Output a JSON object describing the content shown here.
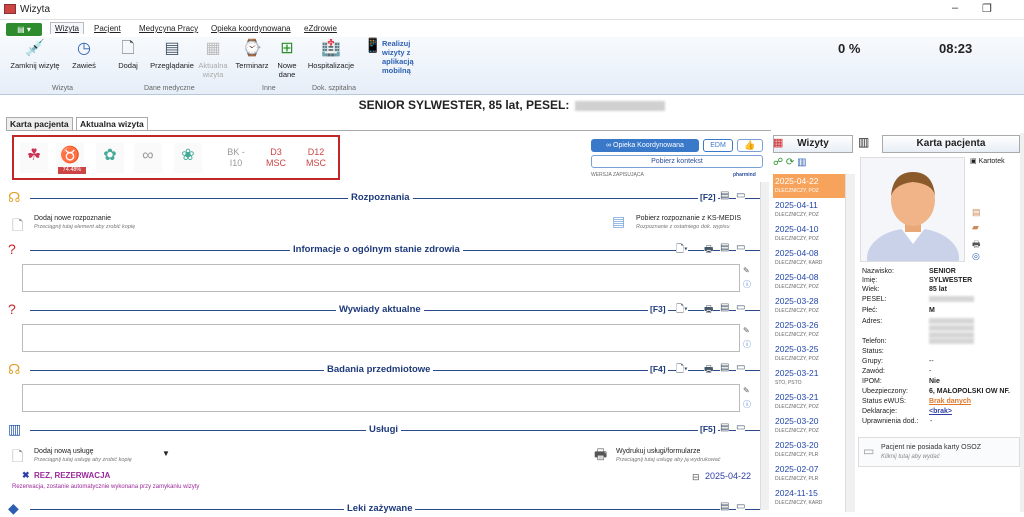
{
  "window": {
    "title": "Wizyta",
    "minimize": "–",
    "restore": "❐"
  },
  "menu": {
    "app_button": "▤ ▾",
    "tabs": [
      "Wizyta",
      "Pacjent",
      "Medycyna Pracy",
      "Opieka koordynowana",
      "eZdrowie"
    ]
  },
  "ribbon": {
    "buttons": [
      {
        "label": "Zamknij wizytę",
        "icon": "syringe-icon"
      },
      {
        "label": "Zawieś",
        "icon": "clock-icon"
      },
      {
        "label": "Dodaj",
        "icon": "document-icon"
      },
      {
        "label": "Przeglądanie",
        "icon": "list-icon"
      },
      {
        "label": "Aktualna wizyta",
        "icon": "calendar-icon"
      },
      {
        "label": "Terminarz",
        "icon": "clock-calendar-icon"
      },
      {
        "label": "Nowe dane",
        "icon": "new-data-icon"
      },
      {
        "label": "Hospitalizacje",
        "icon": "hospital-icon"
      },
      {
        "label": "Realizuj wizyty z aplikacją mobilną",
        "icon": "mobile-icon"
      }
    ],
    "groups": [
      "Wizyta",
      "Dane medyczne",
      "Inne",
      "Dok. szpitalna"
    ],
    "percent": "0 %",
    "clock": "08:23"
  },
  "patient": {
    "header": "SENIOR SYLWESTER, 85 lat, PESEL:"
  },
  "tabs": [
    "Karta pacjenta",
    "Aktualna wizyta"
  ],
  "icon_row": {
    "kidney_percent": "74.48%",
    "text_items": [
      "BK -I10",
      "D3 MSC",
      "D12 MSC"
    ]
  },
  "right_buttons": {
    "opieka": "∞ Opieka Koordynowana",
    "edm": "EDM",
    "pobierz": "Pobierz kontekst",
    "wersja": "WERSJA ZAPISUJĄCA",
    "pharmind": "pharmind"
  },
  "sections": {
    "rozpoznania": {
      "label": "Rozpoznania",
      "fkey": "[F2]"
    },
    "add_diag": {
      "title": "Dodaj nowe rozpoznanie",
      "hint": "Przeciągnij tutaj element aby zrobić kopię"
    },
    "ksmedis": {
      "title": "Pobierz rozpoznanie z KS-MEDIS",
      "hint": "Rozpoznanie z ostatniego dok. wypisu"
    },
    "info": {
      "label": "Informacje o ogólnym stanie zdrowia"
    },
    "wywiady": {
      "label": "Wywiady aktualne",
      "fkey": "[F3]"
    },
    "badania": {
      "label": "Badania przedmiotowe",
      "fkey": "[F4]"
    },
    "uslugi": {
      "label": "Usługi",
      "fkey": "[F5]"
    },
    "add_usluga": {
      "title": "Dodaj nową usługę",
      "hint": "Przeciągnij tutaj usługę aby zrobić kopię"
    },
    "wydrukuj": {
      "title": "Wydrukuj usługi/formularze",
      "hint": "Przeciągnij tutaj usługę aby ją wydrukować"
    },
    "rez": {
      "title": "REZ, REZERWACJA",
      "note": "Rezerwacja, zostanie automatycznie wykonana przy zamykaniu wizyty",
      "date": "2025-04-22"
    },
    "leki": {
      "label": "Leki zażywane"
    }
  },
  "wizyty": {
    "header": "Wizyty",
    "items": [
      {
        "date": "2025-04-22",
        "sub": "DLECZNICZY, POZ"
      },
      {
        "date": "2025-04-11",
        "sub": "DLECZNICZY, POZ"
      },
      {
        "date": "2025-04-10",
        "sub": "DLECZNICZY, POZ"
      },
      {
        "date": "2025-04-08",
        "sub": "DLECZNICZY, KARD"
      },
      {
        "date": "2025-04-08",
        "sub": "DLECZNICZY, POZ"
      },
      {
        "date": "2025-03-28",
        "sub": "DLECZNICZY, POZ"
      },
      {
        "date": "2025-03-26",
        "sub": "DLECZNICZY, POZ"
      },
      {
        "date": "2025-03-25",
        "sub": "DLECZNICZY, POZ"
      },
      {
        "date": "2025-03-21",
        "sub": "STO, PSTO"
      },
      {
        "date": "2025-03-21",
        "sub": "DLECZNICZY, POZ"
      },
      {
        "date": "2025-03-20",
        "sub": "DLECZNICZY, POZ"
      },
      {
        "date": "2025-03-20",
        "sub": "DLECZNICZY, PLR"
      },
      {
        "date": "2025-02-07",
        "sub": "DLECZNICZY, PLR"
      },
      {
        "date": "2024-11-15",
        "sub": "DLECZNICZY, KARD"
      }
    ]
  },
  "karta": {
    "header": "Karta pacjenta",
    "kartoteka": "Kartotek",
    "fields": [
      {
        "label": "Nazwisko:",
        "value": "SENIOR"
      },
      {
        "label": "Imię:",
        "value": "SYLWESTER"
      },
      {
        "label": "Wiek:",
        "value": "85 lat"
      },
      {
        "label": "PESEL:",
        "value": ""
      },
      {
        "label": "Płeć:",
        "value": "M"
      },
      {
        "label": "Adres:",
        "value": ""
      },
      {
        "label": "Telefon:",
        "value": ""
      },
      {
        "label": "Status:",
        "value": ""
      },
      {
        "label": "Grupy:",
        "value": "--"
      },
      {
        "label": "Zawód:",
        "value": "-"
      },
      {
        "label": "IPOM:",
        "value": "Nie"
      },
      {
        "label": "Ubezpieczony:",
        "value": "6, MAŁOPOLSKI OW NF."
      },
      {
        "label": "Status eWUŚ:",
        "value": "Brak danych"
      },
      {
        "label": "Deklaracje:",
        "value": "<brak>"
      },
      {
        "label": "Uprawnienia dod.:",
        "value": "-"
      }
    ],
    "osoz_title": "Pacjent nie posiada karty OSOZ",
    "osoz_hint": "Kliknij tutaj aby wydać"
  }
}
